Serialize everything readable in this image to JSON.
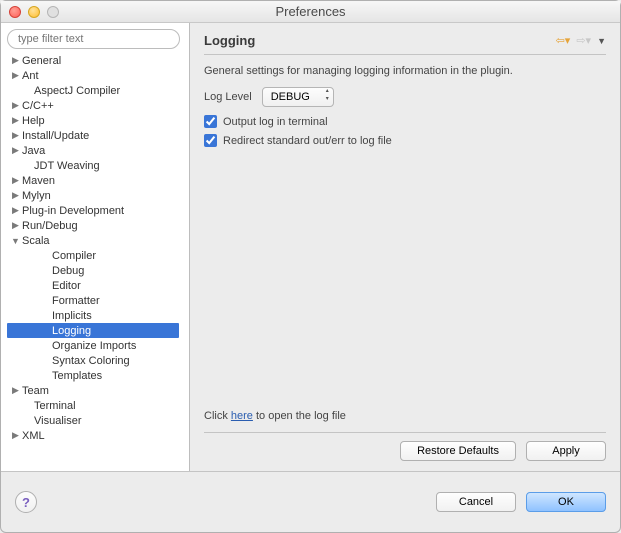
{
  "window": {
    "title": "Preferences"
  },
  "filter": {
    "placeholder": "type filter text"
  },
  "tree": [
    {
      "label": "General",
      "depth": 0,
      "expandable": true,
      "expanded": false
    },
    {
      "label": "Ant",
      "depth": 0,
      "expandable": true,
      "expanded": false
    },
    {
      "label": "AspectJ Compiler",
      "depth": 1,
      "expandable": false
    },
    {
      "label": "C/C++",
      "depth": 0,
      "expandable": true,
      "expanded": false
    },
    {
      "label": "Help",
      "depth": 0,
      "expandable": true,
      "expanded": false
    },
    {
      "label": "Install/Update",
      "depth": 0,
      "expandable": true,
      "expanded": false
    },
    {
      "label": "Java",
      "depth": 0,
      "expandable": true,
      "expanded": false
    },
    {
      "label": "JDT Weaving",
      "depth": 1,
      "expandable": false
    },
    {
      "label": "Maven",
      "depth": 0,
      "expandable": true,
      "expanded": false
    },
    {
      "label": "Mylyn",
      "depth": 0,
      "expandable": true,
      "expanded": false
    },
    {
      "label": "Plug-in Development",
      "depth": 0,
      "expandable": true,
      "expanded": false
    },
    {
      "label": "Run/Debug",
      "depth": 0,
      "expandable": true,
      "expanded": false
    },
    {
      "label": "Scala",
      "depth": 0,
      "expandable": true,
      "expanded": true
    },
    {
      "label": "Compiler",
      "depth": 2,
      "expandable": false
    },
    {
      "label": "Debug",
      "depth": 2,
      "expandable": false
    },
    {
      "label": "Editor",
      "depth": 2,
      "expandable": false
    },
    {
      "label": "Formatter",
      "depth": 2,
      "expandable": false
    },
    {
      "label": "Implicits",
      "depth": 2,
      "expandable": false
    },
    {
      "label": "Logging",
      "depth": 2,
      "expandable": false,
      "selected": true
    },
    {
      "label": "Organize Imports",
      "depth": 2,
      "expandable": false
    },
    {
      "label": "Syntax Coloring",
      "depth": 2,
      "expandable": false
    },
    {
      "label": "Templates",
      "depth": 2,
      "expandable": false
    },
    {
      "label": "Team",
      "depth": 0,
      "expandable": true,
      "expanded": false
    },
    {
      "label": "Terminal",
      "depth": 1,
      "expandable": false
    },
    {
      "label": "Visualiser",
      "depth": 1,
      "expandable": false
    },
    {
      "label": "XML",
      "depth": 0,
      "expandable": true,
      "expanded": false
    }
  ],
  "page": {
    "heading": "Logging",
    "description": "General settings for managing logging information in the plugin.",
    "log_level_label": "Log Level",
    "log_level_value": "DEBUG",
    "cb_output_label": "Output log in terminal",
    "cb_output_checked": true,
    "cb_redirect_label": "Redirect standard out/err to log file",
    "cb_redirect_checked": true,
    "log_line_prefix": "Click ",
    "log_line_link": "here",
    "log_line_suffix": " to open the log file",
    "restore_defaults": "Restore Defaults",
    "apply": "Apply"
  },
  "footer": {
    "cancel": "Cancel",
    "ok": "OK"
  }
}
